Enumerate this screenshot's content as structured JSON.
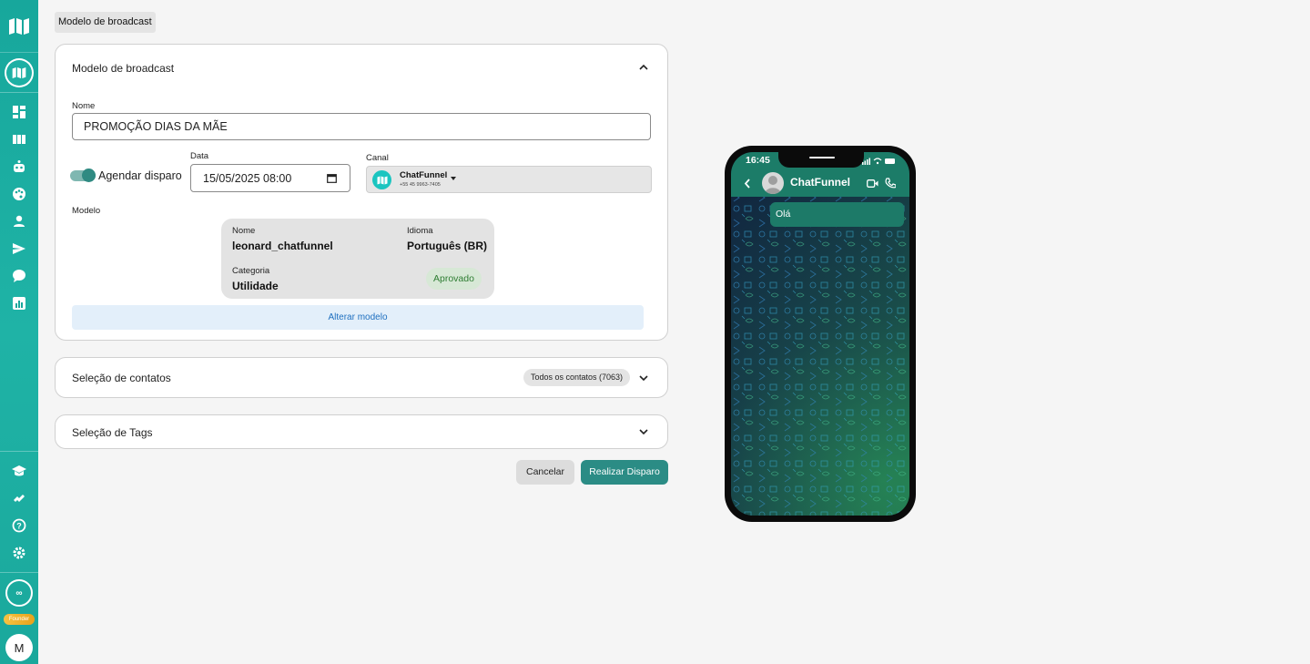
{
  "breadcrumb": "Modelo de broadcast",
  "colors": {
    "accent": "#2b8c85",
    "sidebar": "#1fb3a6",
    "whatsapp_green": "#1c7c68"
  },
  "sidebar": {
    "founder_badge": "Founder",
    "user_initial": "M",
    "icons": [
      "map-logo-icon",
      "dashboard-icon",
      "kanban-icon",
      "bot-icon",
      "palette-icon",
      "contacts-icon",
      "send-icon",
      "chat-icon",
      "reports-icon",
      "academy-icon",
      "integrations-icon",
      "help-icon",
      "settings-icon"
    ]
  },
  "broadcast_card": {
    "title": "Modelo de broadcast",
    "name_label": "Nome",
    "name_value": "PROMOÇÃO DIAS DA MÃE",
    "schedule_label": "Agendar disparo",
    "date_label": "Data",
    "date_value": "15/05/2025 08:00",
    "channel_label": "Canal",
    "channel_name": "ChatFunnel",
    "channel_phone": "+55 45 9963-7405",
    "model_label": "Modelo",
    "model": {
      "name_label": "Nome",
      "name_value": "leonard_chatfunnel",
      "language_label": "Idioma",
      "language_value": "Português (BR)",
      "category_label": "Categoria",
      "category_value": "Utilidade",
      "status": "Aprovado"
    },
    "change_model_label": "Alterar modelo"
  },
  "contacts_card": {
    "title": "Seleção de contatos",
    "chip": "Todos os contatos (7063)"
  },
  "tags_card": {
    "title": "Seleção de Tags"
  },
  "actions": {
    "cancel": "Cancelar",
    "send": "Realizar Disparo"
  },
  "phone_preview": {
    "time": "16:45",
    "contact_name": "ChatFunnel",
    "message": "Olá"
  }
}
